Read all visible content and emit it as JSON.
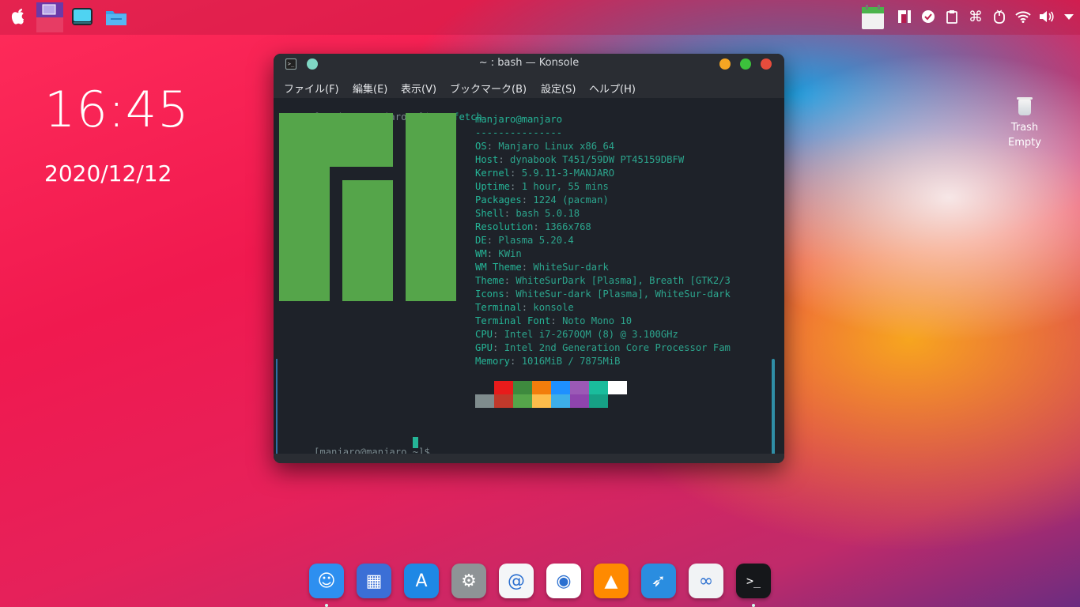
{
  "topbar": {
    "left_icons": [
      "apple-icon",
      "workspace-pager-icon",
      "tv-app-icon",
      "files-folder-icon"
    ],
    "tray_icons": [
      "calendar-icon",
      "manjaro-icon",
      "check-circle-icon",
      "clipboard-icon",
      "command-icon",
      "mouse-icon",
      "wifi-icon",
      "volume-icon",
      "chevron-down-icon"
    ]
  },
  "desktop": {
    "time": "16:45",
    "date": "2020/12/12",
    "trash_label": "Trash",
    "trash_status": "Empty"
  },
  "window": {
    "title": "~ : bash — Konsole",
    "menu": [
      "ファイル(F)",
      "編集(E)",
      "表示(V)",
      "ブックマーク(B)",
      "設定(S)",
      "ヘルプ(H)"
    ],
    "prompt": "[manjaro@manjaro ~]$",
    "command": "neofetch",
    "info_header": "manjaro@manjaro",
    "info_sep": "---------------",
    "info": [
      {
        "k": "OS",
        "v": "Manjaro Linux x86_64"
      },
      {
        "k": "Host",
        "v": "dynabook T451/59DW PT45159DBFW"
      },
      {
        "k": "Kernel",
        "v": "5.9.11-3-MANJARO"
      },
      {
        "k": "Uptime",
        "v": "1 hour, 55 mins"
      },
      {
        "k": "Packages",
        "v": "1224 (pacman)"
      },
      {
        "k": "Shell",
        "v": "bash 5.0.18"
      },
      {
        "k": "Resolution",
        "v": "1366x768"
      },
      {
        "k": "DE",
        "v": "Plasma 5.20.4"
      },
      {
        "k": "WM",
        "v": "KWin"
      },
      {
        "k": "WM Theme",
        "v": "WhiteSur-dark"
      },
      {
        "k": "Theme",
        "v": "WhiteSurDark [Plasma], Breath [GTK2/3"
      },
      {
        "k": "Icons",
        "v": "WhiteSur-dark [Plasma], WhiteSur-dark"
      },
      {
        "k": "Terminal",
        "v": "konsole"
      },
      {
        "k": "Terminal Font",
        "v": "Noto Mono 10"
      },
      {
        "k": "CPU",
        "v": "Intel i7-2670QM (8) @ 3.100GHz"
      },
      {
        "k": "GPU",
        "v": "Intel 2nd Generation Core Processor Fam"
      },
      {
        "k": "Memory",
        "v": "1016MiB / 7875MiB"
      }
    ],
    "swatch_row1": [
      "#1e2229",
      "#e81b1b",
      "#3e8a3e",
      "#f27d0c",
      "#1e90ff",
      "#9b59b6",
      "#1abc9c",
      "#ffffff"
    ],
    "swatch_row2": [
      "#7f8c8d",
      "#c0392b",
      "#55a54a",
      "#fdbc4b",
      "#3daee9",
      "#8e44ad",
      "#16a085",
      "#1e2229"
    ],
    "controls": {
      "minimize": "#f5a623",
      "maximize": "#3cc23c",
      "close": "#e74c3c"
    }
  },
  "dock": [
    {
      "name": "finder",
      "bg": "#2d8ff0",
      "glyph": "☺"
    },
    {
      "name": "launchpad",
      "bg": "#3b6fd6",
      "glyph": "▦"
    },
    {
      "name": "app-store",
      "bg": "#1e88e5",
      "glyph": "A"
    },
    {
      "name": "system-settings",
      "bg": "#8e9396",
      "glyph": "⚙"
    },
    {
      "name": "mail",
      "bg": "#f4f6f8",
      "glyph": "@"
    },
    {
      "name": "firefox",
      "bg": "#ffffff",
      "glyph": "◉"
    },
    {
      "name": "vlc",
      "bg": "#ff8a00",
      "glyph": "▲"
    },
    {
      "name": "swift",
      "bg": "#2a8de0",
      "glyph": "➶"
    },
    {
      "name": "preview",
      "bg": "#f1f3f5",
      "glyph": "∞"
    },
    {
      "name": "terminal",
      "bg": "#15171a",
      "glyph": ">_"
    }
  ]
}
